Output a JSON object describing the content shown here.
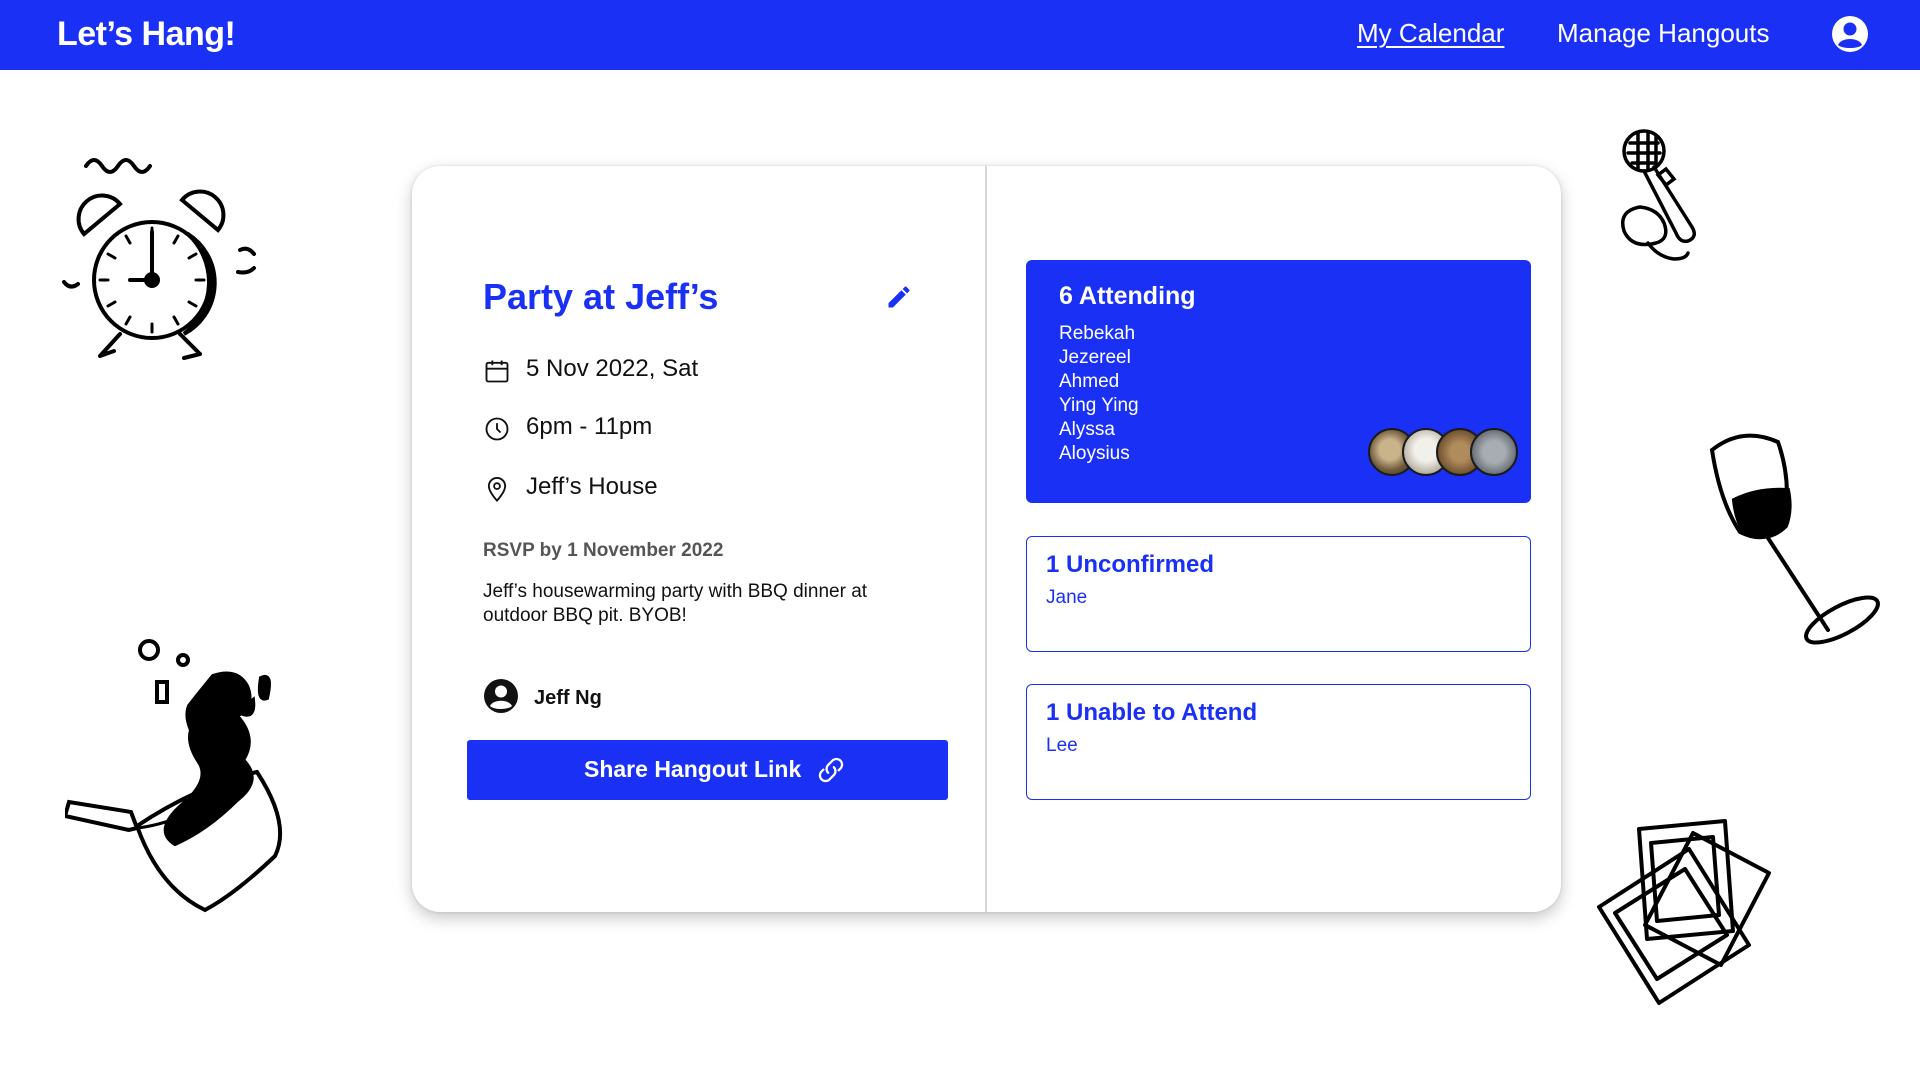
{
  "nav": {
    "brand": "Let’s Hang!",
    "links": [
      {
        "label": "My Calendar",
        "active": true
      },
      {
        "label": "Manage Hangouts",
        "active": false
      }
    ],
    "account_icon": "account-circle-icon"
  },
  "hangout": {
    "title": "Party at Jeff’s",
    "date": "5 Nov 2022, Sat",
    "time": "6pm - 11pm",
    "location": "Jeff’s House",
    "rsvp": "RSVP by 1 November 2022",
    "description": "Jeff’s housewarming party with BBQ dinner at outdoor BBQ pit. BYOB!",
    "host": "Jeff Ng",
    "share_label": "Share Hangout Link"
  },
  "attending": {
    "title": "6 Attending",
    "names": [
      "Rebekah",
      "Jezereel",
      "Ahmed",
      "Ying Ying",
      "Alyssa",
      "Aloysius"
    ]
  },
  "unconfirmed": {
    "title": "1 Unconfirmed",
    "names": [
      "Jane"
    ]
  },
  "unable": {
    "title": "1 Unable to Attend",
    "names": [
      "Lee"
    ]
  },
  "colors": {
    "accent": "#1a31f5",
    "background": "#ffffff",
    "text": "#111111"
  },
  "icons": [
    "pencil-icon",
    "calendar-icon",
    "clock-icon",
    "location-pin-icon",
    "account-circle-icon",
    "link-icon",
    "cat-avatar-icon"
  ]
}
